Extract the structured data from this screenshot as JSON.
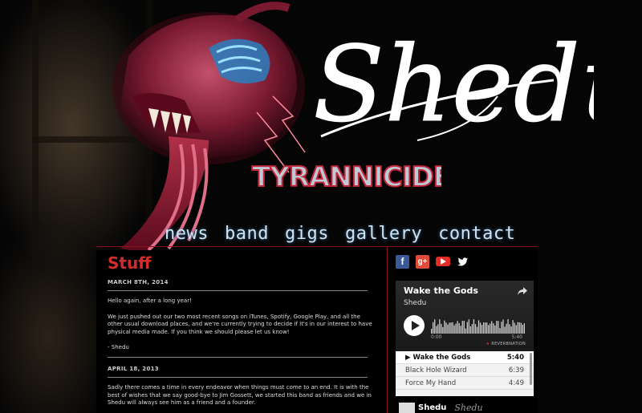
{
  "brand": {
    "logo_text": "Shedu",
    "album_logo_text": "TYRANNICIDE"
  },
  "nav": {
    "items": [
      "news",
      "band",
      "gigs",
      "gallery",
      "contact"
    ]
  },
  "main": {
    "title": "Stuff",
    "posts": [
      {
        "date": "MARCH 8TH, 2014",
        "paragraphs": [
          "Hello again, after a long year!",
          "We just pushed out our two most recent songs on iTunes, Spotify, Google Play, and all the other usual download places, and we're currently trying to decide if it's in our interest to have physical media made. If you think we should please let us know!",
          "- Shedu"
        ]
      },
      {
        "date": "APRIL 18, 2013",
        "paragraphs": [
          "Sadly there comes a time in every endeavor when things must come to an end. It is with the best of wishes that we say good-bye to Jim Gossett, we started this band as friends and we in Shedu will always see him as a friend and a founder."
        ]
      }
    ]
  },
  "sidebar": {
    "social": [
      {
        "name": "facebook",
        "glyph": "f"
      },
      {
        "name": "google-plus",
        "glyph": "g+"
      },
      {
        "name": "youtube",
        "glyph": "▶"
      },
      {
        "name": "twitter",
        "glyph": "🐦"
      }
    ],
    "player": {
      "track_title": "Wake the Gods",
      "artist": "Shedu",
      "time_start": "0:00",
      "time_end": "5:40",
      "provider": "REVERBNATION",
      "tracks": [
        {
          "title": "▶ Wake the Gods",
          "duration": "5:40",
          "active": true
        },
        {
          "title": "Black Hole Wizard",
          "duration": "6:39",
          "active": false
        },
        {
          "title": "Force My Hand",
          "duration": "4:49",
          "active": false
        }
      ]
    },
    "footer_badge_name": "Shedu",
    "footer_script": "Shedu"
  },
  "colors": {
    "accent_red": "#d12d2d",
    "nav_blue": "#cfe3f2",
    "divider_red": "#8a1020"
  }
}
